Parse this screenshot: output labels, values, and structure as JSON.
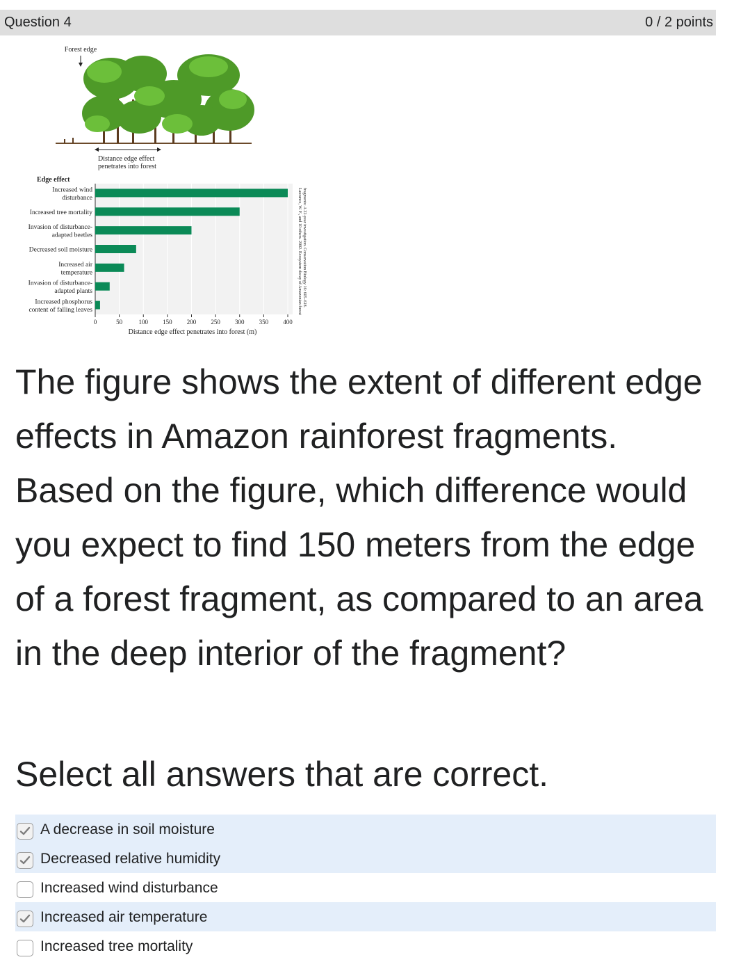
{
  "question": {
    "title": "Question 4",
    "points": "0 / 2 points"
  },
  "figure": {
    "forest_edge_label": "Forest edge",
    "distance_label_line1": "Distance edge effect",
    "distance_label_line2": "penetrates into forest",
    "credit_line1": "Laurance, W. F., and 10 others. 2002. Ecosystem decay of Amazonian forest",
    "credit_line2": "fragments: A 22-year investigation. Conservation Biology 16: 605–618."
  },
  "chart_data": {
    "type": "bar",
    "orientation": "horizontal",
    "legend_title": "Edge effect",
    "categories": [
      [
        "Increased wind",
        "disturbance"
      ],
      [
        "Increased tree mortality"
      ],
      [
        "Invasion of disturbance-",
        "adapted beetles"
      ],
      [
        "Decreased soil moisture"
      ],
      [
        "Increased air",
        "temperature"
      ],
      [
        "Invasion of disturbance-",
        "adapted plants"
      ],
      [
        "Increased phosphorus",
        "content of falling leaves"
      ]
    ],
    "values": [
      400,
      300,
      200,
      85,
      60,
      30,
      10
    ],
    "xlabel": "Distance edge effect penetrates into forest (m)",
    "xlim": [
      0,
      400
    ],
    "xticks": [
      "0",
      "50",
      "100",
      "150",
      "200",
      "250",
      "300",
      "350",
      "400"
    ],
    "bar_color": "#0b8a57",
    "background": "#f2f2f2",
    "grid": true
  },
  "question_text": "The figure shows the extent of different edge effects in Amazon rainforest fragments. Based on the figure, which difference would you expect to find 150 meters from the edge of a forest fragment, as compared to an area in the deep interior of the fragment?",
  "instruction": "Select all answers that are correct.",
  "answers": [
    {
      "label": "A decrease in soil moisture",
      "checked": true
    },
    {
      "label": "Decreased relative humidity",
      "checked": true
    },
    {
      "label": "Increased wind disturbance",
      "checked": false
    },
    {
      "label": "Increased air temperature",
      "checked": true
    },
    {
      "label": "Increased tree mortality",
      "checked": false
    }
  ]
}
